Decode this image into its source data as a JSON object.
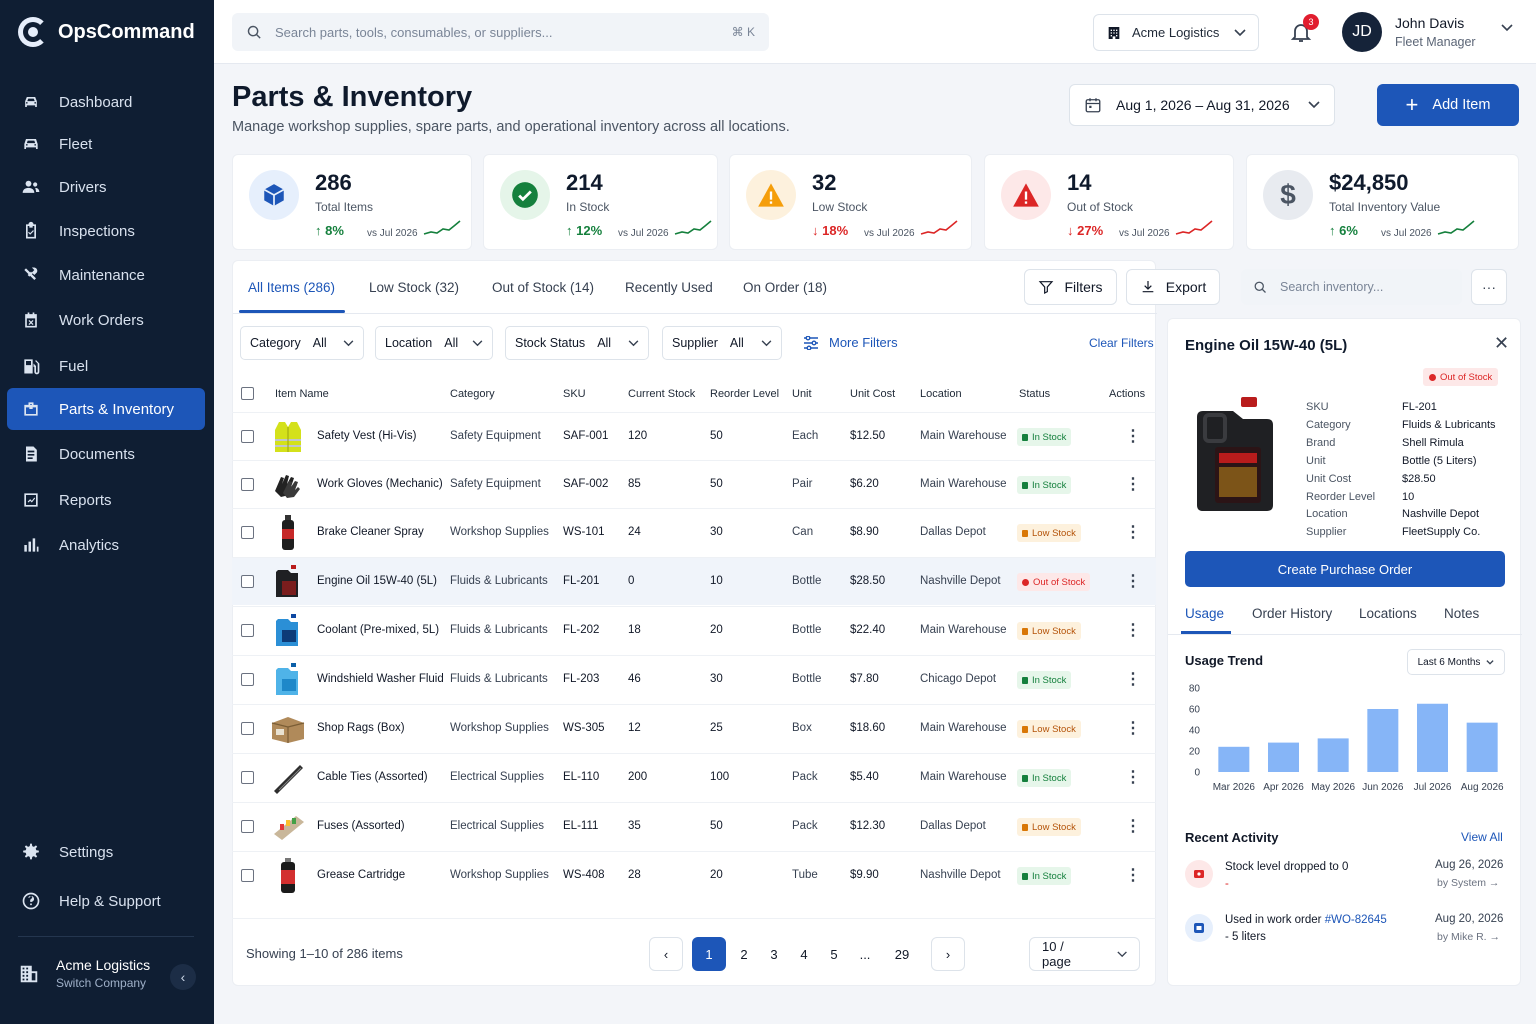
{
  "app": {
    "name": "OpsCommand"
  },
  "sidebar": {
    "items": [
      {
        "label": "Dashboard",
        "icon": "car-icon"
      },
      {
        "label": "Fleet",
        "icon": "car-front-icon"
      },
      {
        "label": "Drivers",
        "icon": "users-icon"
      },
      {
        "label": "Inspections",
        "icon": "clipboard-check-icon"
      },
      {
        "label": "Maintenance",
        "icon": "tools-icon"
      },
      {
        "label": "Work Orders",
        "icon": "calendar-x-icon"
      },
      {
        "label": "Fuel",
        "icon": "fuel-pump-icon"
      },
      {
        "label": "Parts & Inventory",
        "icon": "toolbox-icon",
        "active": true
      },
      {
        "label": "Documents",
        "icon": "document-icon"
      },
      {
        "label": "Reports",
        "icon": "chart-box-icon"
      },
      {
        "label": "Analytics",
        "icon": "bar-chart-icon"
      }
    ],
    "bottom": [
      {
        "label": "Settings",
        "icon": "gear-icon"
      },
      {
        "label": "Help & Support",
        "icon": "help-circle-icon"
      }
    ],
    "company": {
      "name": "Acme Logistics",
      "sub": "Switch Company"
    }
  },
  "topbar": {
    "search_placeholder": "Search parts, tools, consumables, or suppliers...",
    "shortcut": "⌘ K",
    "org": "Acme Logistics",
    "notifications": "3",
    "user": {
      "initials": "JD",
      "name": "John Davis",
      "role": "Fleet Manager"
    }
  },
  "page": {
    "title": "Parts & Inventory",
    "subtitle": "Manage workshop supplies, spare parts, and operational inventory across all locations.",
    "date_range": "Aug 1, 2026 – Aug 31, 2026",
    "add_label": "Add Item"
  },
  "kpis": [
    {
      "value": "286",
      "label": "Total Items",
      "delta": "8%",
      "direction": "up",
      "vs": "vs Jul 2026",
      "color": "#1d56b8"
    },
    {
      "value": "214",
      "label": "In Stock",
      "delta": "12%",
      "direction": "up",
      "vs": "vs Jul 2026",
      "color": "#15803d"
    },
    {
      "value": "32",
      "label": "Low Stock",
      "delta": "18%",
      "direction": "down",
      "vs": "vs Jul 2026",
      "color": "#f59e0b"
    },
    {
      "value": "14",
      "label": "Out of Stock",
      "delta": "27%",
      "direction": "down",
      "vs": "vs Jul 2026",
      "color": "#dc2626"
    },
    {
      "value": "$24,850",
      "label": "Total Inventory Value",
      "delta": "6%",
      "direction": "up",
      "vs": "vs Jul 2026",
      "color": "#4b5563"
    }
  ],
  "tabs": [
    "All Items (286)",
    "Low Stock (32)",
    "Out of Stock (14)",
    "Recently Used",
    "On Order (18)"
  ],
  "toolbar": {
    "filters": "Filters",
    "export": "Export",
    "search_placeholder": "Search inventory...",
    "more": "···"
  },
  "filters": {
    "category": {
      "label": "Category",
      "value": "All"
    },
    "location": {
      "label": "Location",
      "value": "All"
    },
    "stock_status": {
      "label": "Stock Status",
      "value": "All"
    },
    "supplier": {
      "label": "Supplier",
      "value": "All"
    },
    "more": "More Filters",
    "clear": "Clear Filters"
  },
  "table": {
    "columns": [
      "Item Name",
      "Category",
      "SKU",
      "Current Stock",
      "Reorder Level",
      "Unit",
      "Unit Cost",
      "Location",
      "Status",
      "Actions"
    ],
    "rows": [
      {
        "name": "Safety Vest (Hi-Vis)",
        "category": "Safety Equipment",
        "sku": "SAF-001",
        "stock": "120",
        "reorder": "50",
        "unit": "Each",
        "cost": "$12.50",
        "location": "Main Warehouse",
        "status": "In Stock",
        "thumb": "vest-icon"
      },
      {
        "name": "Work Gloves (Mechanic)",
        "category": "Safety Equipment",
        "sku": "SAF-002",
        "stock": "85",
        "reorder": "50",
        "unit": "Pair",
        "cost": "$6.20",
        "location": "Main Warehouse",
        "status": "In Stock",
        "thumb": "gloves-icon"
      },
      {
        "name": "Brake Cleaner Spray",
        "category": "Workshop Supplies",
        "sku": "WS-101",
        "stock": "24",
        "reorder": "30",
        "unit": "Can",
        "cost": "$8.90",
        "location": "Dallas Depot",
        "status": "Low Stock",
        "thumb": "spray-can-icon"
      },
      {
        "name": "Engine Oil 15W-40 (5L)",
        "category": "Fluids & Lubricants",
        "sku": "FL-201",
        "stock": "0",
        "reorder": "10",
        "unit": "Bottle",
        "cost": "$28.50",
        "location": "Nashville Depot",
        "status": "Out of Stock",
        "thumb": "oil-jug-icon",
        "selected": true
      },
      {
        "name": "Coolant (Pre-mixed, 5L)",
        "category": "Fluids & Lubricants",
        "sku": "FL-202",
        "stock": "18",
        "reorder": "20",
        "unit": "Bottle",
        "cost": "$22.40",
        "location": "Main Warehouse",
        "status": "Low Stock",
        "thumb": "coolant-jug-icon"
      },
      {
        "name": "Windshield Washer Fluid",
        "category": "Fluids & Lubricants",
        "sku": "FL-203",
        "stock": "46",
        "reorder": "30",
        "unit": "Bottle",
        "cost": "$7.80",
        "location": "Chicago Depot",
        "status": "In Stock",
        "thumb": "washer-jug-icon"
      },
      {
        "name": "Shop Rags (Box)",
        "category": "Workshop Supplies",
        "sku": "WS-305",
        "stock": "12",
        "reorder": "25",
        "unit": "Box",
        "cost": "$18.60",
        "location": "Main Warehouse",
        "status": "Low Stock",
        "thumb": "rag-box-icon"
      },
      {
        "name": "Cable Ties (Assorted)",
        "category": "Electrical Supplies",
        "sku": "EL-110",
        "stock": "200",
        "reorder": "100",
        "unit": "Pack",
        "cost": "$5.40",
        "location": "Main Warehouse",
        "status": "In Stock",
        "thumb": "cable-ties-icon"
      },
      {
        "name": "Fuses (Assorted)",
        "category": "Electrical Supplies",
        "sku": "EL-111",
        "stock": "35",
        "reorder": "50",
        "unit": "Pack",
        "cost": "$12.30",
        "location": "Dallas Depot",
        "status": "Low Stock",
        "thumb": "fuses-icon"
      },
      {
        "name": "Grease Cartridge",
        "category": "Workshop Supplies",
        "sku": "WS-408",
        "stock": "28",
        "reorder": "20",
        "unit": "Tube",
        "cost": "$9.90",
        "location": "Nashville Depot",
        "status": "In Stock",
        "thumb": "grease-tube-icon"
      }
    ]
  },
  "pagination": {
    "showing": "Showing 1–10 of 286 items",
    "pages": [
      "1",
      "2",
      "3",
      "4",
      "5",
      "...",
      "29"
    ],
    "current": "1",
    "per_page": "10 / page"
  },
  "detail": {
    "title": "Engine Oil 15W-40 (5L)",
    "status": "Out of Stock",
    "specs": [
      {
        "k": "SKU",
        "v": "FL-201"
      },
      {
        "k": "Category",
        "v": "Fluids & Lubricants"
      },
      {
        "k": "Brand",
        "v": "Shell Rimula"
      },
      {
        "k": "Unit",
        "v": "Bottle (5 Liters)"
      },
      {
        "k": "Unit Cost",
        "v": "$28.50"
      },
      {
        "k": "Reorder Level",
        "v": "10"
      },
      {
        "k": "Location",
        "v": "Nashville Depot"
      },
      {
        "k": "Supplier",
        "v": "FleetSupply Co."
      }
    ],
    "po_button": "Create Purchase Order",
    "tabs": [
      "Usage",
      "Order History",
      "Locations",
      "Notes"
    ],
    "usage_title": "Usage Trend",
    "range": "Last 6 Months",
    "recent_title": "Recent Activity",
    "view_all": "View All",
    "activity": [
      {
        "text": "Stock level dropped to 0",
        "extra": "-",
        "date": "Aug 26, 2026",
        "by": "by System →"
      },
      {
        "text_pre": "Used in work order ",
        "link": "#WO-82645",
        "extra": "- 5 liters",
        "date": "Aug 20, 2026",
        "by": "by Mike R. →"
      }
    ]
  },
  "chart_data": {
    "type": "bar",
    "categories": [
      "Mar 2026",
      "Apr 2026",
      "May 2026",
      "Jun 2026",
      "Jul 2026",
      "Aug 2026"
    ],
    "values": [
      24,
      28,
      32,
      60,
      65,
      47
    ],
    "ylim": [
      0,
      80
    ],
    "yticks": [
      0,
      20,
      40,
      60,
      80
    ],
    "color": "#86b5f7",
    "grid": false
  }
}
